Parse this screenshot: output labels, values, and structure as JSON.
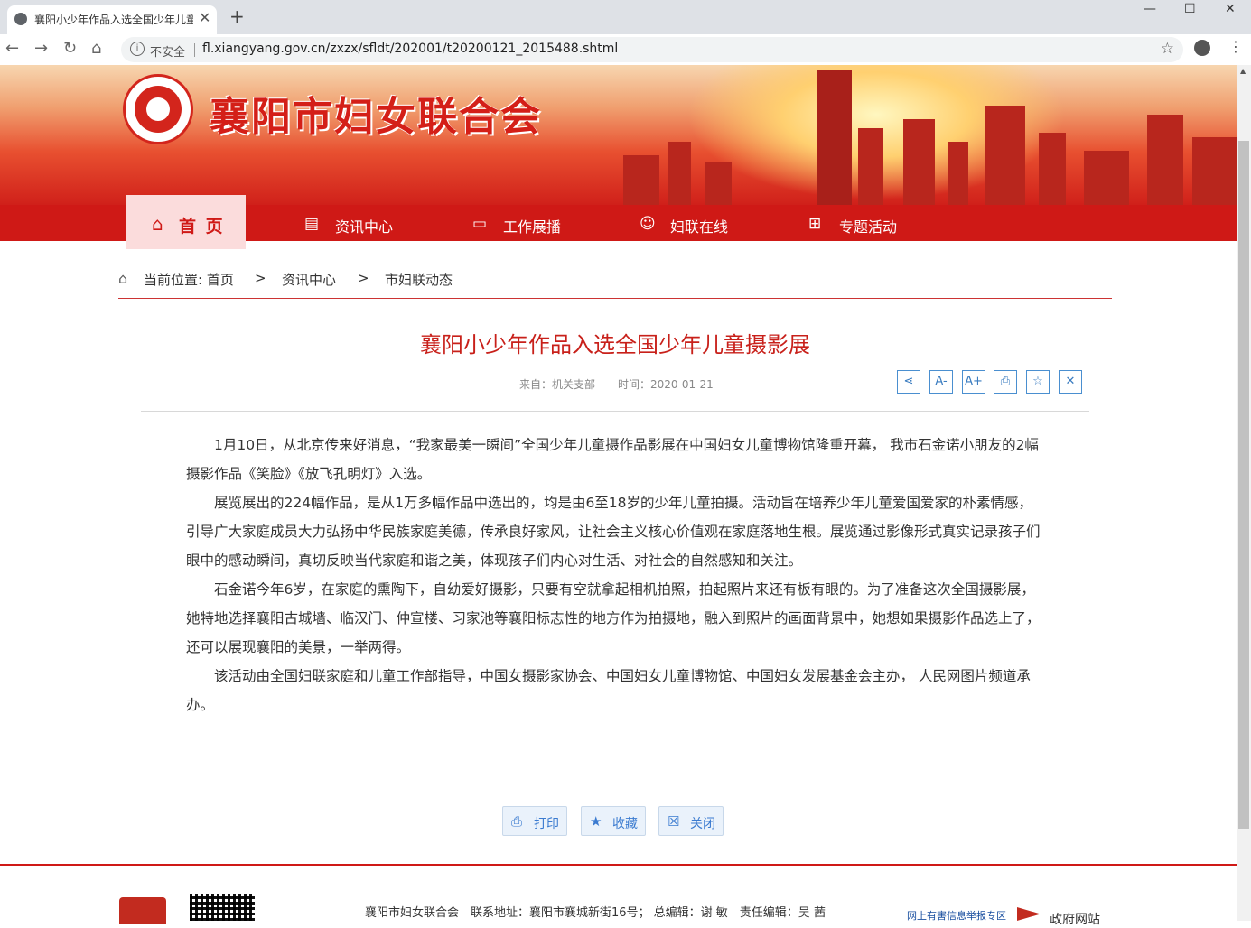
{
  "browser": {
    "tab_title": "襄阳小少年作品入选全国少年儿童",
    "new_tab": "+",
    "minimize": "—",
    "maximize": "☐",
    "close": "✕",
    "back": "←",
    "forward": "→",
    "reload": "↻",
    "home": "⌂",
    "security_label": "不安全",
    "url": "fl.xiangyang.gov.cn/zxzx/sfldt/202001/t20200121_2015488.shtml",
    "bookmark": "☆",
    "menu": "⋮"
  },
  "site": {
    "name": "襄阳市妇女联合会"
  },
  "nav": {
    "home": "首 页",
    "items": [
      "资讯中心",
      "工作展播",
      "妇联在线",
      "专题活动"
    ],
    "icons": [
      "news-icon",
      "monitor-icon",
      "people-icon",
      "grid-icon"
    ]
  },
  "breadcrumb": {
    "label": "当前位置: 首页",
    "sep1": ">",
    "level2": "资讯中心",
    "sep2": ">",
    "level3": "市妇联动态"
  },
  "article": {
    "title": "襄阳小少年作品入选全国少年儿童摄影展",
    "source": "来自：机关支部",
    "time": "时间：2020-01-21",
    "paragraphs": [
      "1月10日，从北京传来好消息，“我家最美一瞬间”全国少年儿童摄作品影展在中国妇女儿童博物馆隆重开幕， 我市石金诺小朋友的2幅摄影作品《笑脸》《放飞孔明灯》入选。",
      "展览展出的224幅作品，是从1万多幅作品中选出的，均是由6至18岁的少年儿童拍摄。活动旨在培养少年儿童爱国爱家的朴素情感，引导广大家庭成员大力弘扬中华民族家庭美德，传承良好家风，让社会主义核心价值观在家庭落地生根。展览通过影像形式真实记录孩子们眼中的感动瞬间，真切反映当代家庭和谐之美，体现孩子们内心对生活、对社会的自然感知和关注。",
      "石金诺今年6岁，在家庭的熏陶下，自幼爱好摄影，只要有空就拿起相机拍照，拍起照片来还有板有眼的。为了准备这次全国摄影展，她特地选择襄阳古城墙、临汉门、仲宣楼、习家池等襄阳标志性的地方作为拍摄地，融入到照片的画面背景中，她想如果摄影作品选上了，还可以展现襄阳的美景，一举两得。",
      "该活动由全国妇联家庭和儿童工作部指导，中国女摄影家协会、中国妇女儿童博物馆、中国妇女发展基金会主办， 人民网图片频道承办。"
    ]
  },
  "tools": {
    "share": "⋖",
    "font_small": "A-",
    "font_large": "A+",
    "print": "⎙",
    "favorite": "☆",
    "close": "✕"
  },
  "buttons": {
    "print": "打印",
    "favorite": "收藏",
    "close": "关闭"
  },
  "footer": {
    "info": "襄阳市妇女联合会　联系地址：襄阳市襄城新街16号；  总编辑：谢 敏　责任编辑：吴 茜",
    "report": "网上有害信息举报专区",
    "gov": "政府网站"
  },
  "colors": {
    "brand_red": "#cf1916",
    "title_red": "#c8201a",
    "tool_blue": "#3a7cc0"
  }
}
